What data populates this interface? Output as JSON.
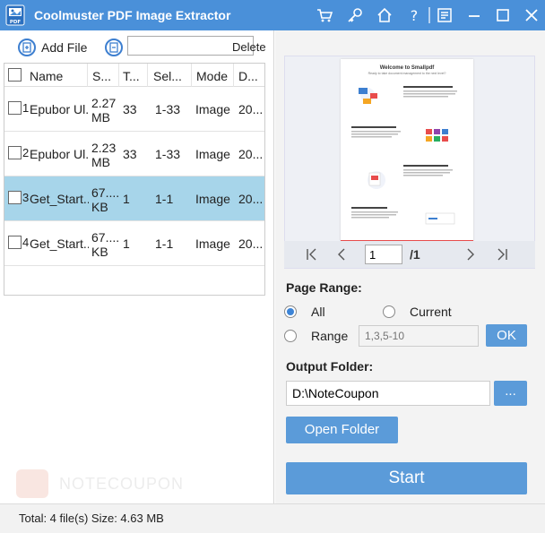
{
  "app": {
    "title": "Coolmuster PDF Image Extractor",
    "logo_text": "PDF",
    "accent": "#4a90d9"
  },
  "titlebar_icons": [
    "cart-icon",
    "key-icon",
    "home-icon",
    "help-icon",
    "feedback-icon",
    "minimize-icon",
    "maximize-icon",
    "close-icon"
  ],
  "toolbar": {
    "add_file_label": "Add File",
    "search_value": "",
    "delete_label": "Delete"
  },
  "table": {
    "headers": [
      "Name",
      "S...",
      "T...",
      "Sel...",
      "Mode",
      "D..."
    ],
    "rows": [
      {
        "index": "1",
        "name": "Epubor Ul...",
        "size": "2.27 MB",
        "total": "33",
        "selected": "1-33",
        "mode": "Image",
        "date": "20...",
        "is_selected": false
      },
      {
        "index": "2",
        "name": "Epubor Ul...",
        "size": "2.23 MB",
        "total": "33",
        "selected": "1-33",
        "mode": "Image",
        "date": "20...",
        "is_selected": false
      },
      {
        "index": "3",
        "name": "Get_Start...",
        "size": "67.... KB",
        "total": "1",
        "selected": "1-1",
        "mode": "Image",
        "date": "20...",
        "is_selected": true
      },
      {
        "index": "4",
        "name": "Get_Start...",
        "size": "67.... KB",
        "total": "1",
        "selected": "1-1",
        "mode": "Image",
        "date": "20...",
        "is_selected": false
      }
    ]
  },
  "preview": {
    "page_title": "Welcome to Smallpdf",
    "page_subtitle": "Ready to take document management to the next level?",
    "current_page": "1",
    "total_pages": "/1"
  },
  "page_range": {
    "label": "Page Range:",
    "all_label": "All",
    "current_label": "Current",
    "range_label": "Range",
    "range_placeholder": "1,3,5-10",
    "ok_label": "OK",
    "selected": "all"
  },
  "output": {
    "label": "Output Folder:",
    "path": "D:\\NoteCoupon",
    "browse_label": "...",
    "open_folder_label": "Open Folder",
    "start_label": "Start"
  },
  "watermark": {
    "text": "NOTECOUPON"
  },
  "status": {
    "text": "Total: 4 file(s) Size: 4.63 MB"
  }
}
